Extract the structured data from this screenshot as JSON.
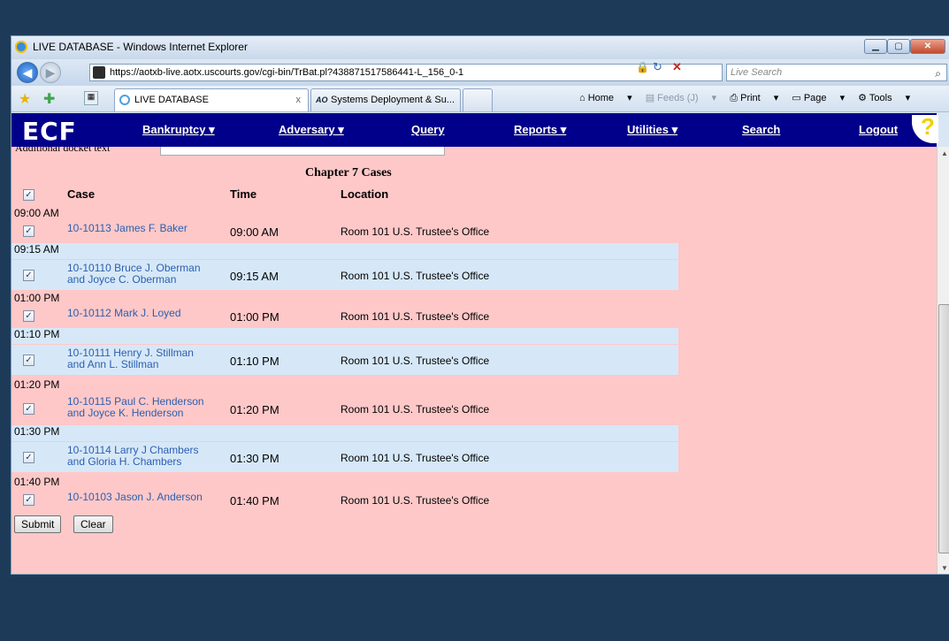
{
  "window": {
    "title": "LIVE DATABASE - Windows Internet Explorer"
  },
  "address": {
    "url": "https://aotxb-live.aotx.uscourts.gov/cgi-bin/TrBat.pl?438871517586441-L_156_0-1",
    "search_placeholder": "Live Search"
  },
  "tabs": [
    {
      "label": "LIVE DATABASE"
    },
    {
      "label": "Systems Deployment & Su..."
    }
  ],
  "tab2_icon_text": "AO",
  "commands": {
    "home": "Home",
    "feeds": "Feeds (J)",
    "print": "Print",
    "page": "Page",
    "tools": "Tools"
  },
  "ecf": {
    "logo": "ECF",
    "menu": [
      "Bankruptcy ▾",
      "Adversary ▾",
      "Query",
      "Reports ▾",
      "Utilities ▾",
      "Search",
      "Logout"
    ],
    "help": "?"
  },
  "form": {
    "additional_label": "Additional docket text",
    "section_title": "Chapter 7 Cases",
    "headers": {
      "case": "Case",
      "time": "Time",
      "location": "Location"
    },
    "groups": [
      {
        "label": "09:00 AM",
        "case1": "10-10113 James F. Baker",
        "case2": "",
        "time": "09:00 AM",
        "location": "Room 101 U.S. Trustee's Office"
      },
      {
        "label": "09:15 AM",
        "case1": "10-10110 Bruce J. Oberman",
        "case2": "and Joyce C. Oberman",
        "time": "09:15 AM",
        "location": "Room 101 U.S. Trustee's Office"
      },
      {
        "label": "01:00 PM",
        "case1": "10-10112 Mark J. Loyed",
        "case2": "",
        "time": "01:00 PM",
        "location": "Room 101 U.S. Trustee's Office"
      },
      {
        "label": "01:10 PM",
        "case1": "10-10111 Henry J. Stillman",
        "case2": "and Ann L. Stillman",
        "time": "01:10 PM",
        "location": "Room 101 U.S. Trustee's Office"
      },
      {
        "label": "01:20 PM",
        "case1": "10-10115 Paul C. Henderson",
        "case2": "and Joyce K. Henderson",
        "time": "01:20 PM",
        "location": "Room 101 U.S. Trustee's Office"
      },
      {
        "label": "01:30 PM",
        "case1": "10-10114 Larry J Chambers",
        "case2": "and Gloria H. Chambers",
        "time": "01:30 PM",
        "location": "Room 101 U.S. Trustee's Office"
      },
      {
        "label": "01:40 PM",
        "case1": "10-10103 Jason J. Anderson",
        "case2": "",
        "time": "01:40 PM",
        "location": "Room 101 U.S. Trustee's Office"
      }
    ],
    "submit": "Submit",
    "clear": "Clear"
  },
  "colors": {
    "page_bg": "#ffc8c8",
    "row_blue": "#d6e8f8",
    "ecf_bar": "#00008a",
    "link": "#2b5fb0"
  }
}
